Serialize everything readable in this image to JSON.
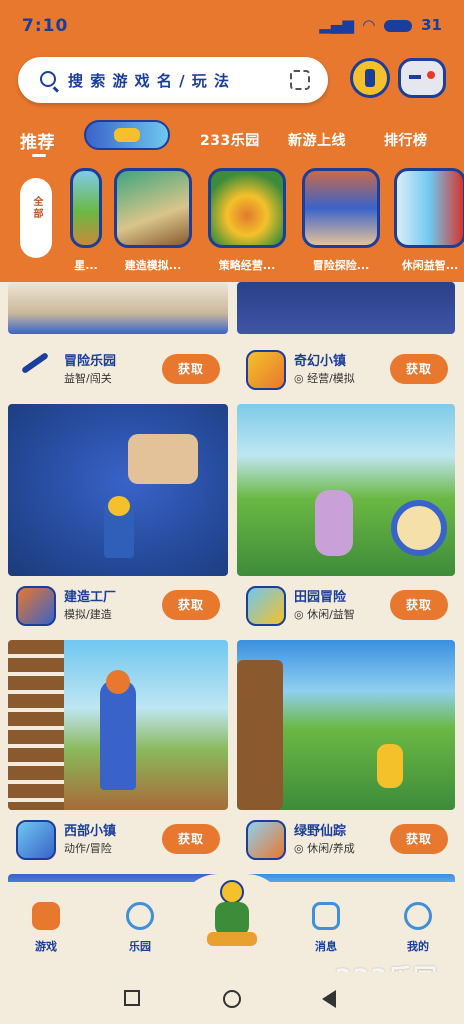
{
  "status": {
    "time": "7:10",
    "icons": [
      "signal-icon",
      "wifi-icon",
      "battery-icon"
    ],
    "battery_text": "31"
  },
  "search": {
    "placeholder": "搜 索 游 戏 名 / 玩 法"
  },
  "tabs": [
    {
      "label": "推荐",
      "active": true
    },
    {
      "label": "233乐园",
      "active": false
    },
    {
      "label": "新游上线",
      "active": false
    },
    {
      "label": "排行榜",
      "active": false
    }
  ],
  "side_tab": {
    "label": "全部"
  },
  "chips": [
    {
      "label": "星..."
    },
    {
      "label": "建造模拟..."
    },
    {
      "label": "策略经营..."
    },
    {
      "label": "冒险探险..."
    },
    {
      "label": "休闲益智..."
    }
  ],
  "cards": [
    {
      "title": "冒险乐园",
      "subtitle": "益智/闯关",
      "button": "获取"
    },
    {
      "title": "奇幻小镇",
      "subtitle": "◎ 经营/模拟",
      "button": "获取"
    },
    {
      "title": "建造工厂",
      "subtitle": "模拟/建造",
      "button": "获取"
    },
    {
      "title": "田园冒险",
      "subtitle": "◎ 休闲/益智",
      "button": "获取"
    },
    {
      "title": "西部小镇",
      "subtitle": "动作/冒险",
      "button": "获取"
    },
    {
      "title": "绿野仙踪",
      "subtitle": "◎ 休闲/养成",
      "button": "获取"
    }
  ],
  "bottom_nav": [
    {
      "label": "游戏",
      "icon": "gamepad-icon",
      "active": true
    },
    {
      "label": "乐园",
      "icon": "planet-icon",
      "active": false
    },
    {
      "label": "消息",
      "icon": "message-icon",
      "active": false
    },
    {
      "label": "我的",
      "icon": "user-icon",
      "active": false
    }
  ],
  "watermark": "233乐园",
  "colors": {
    "accent": "#e8782e",
    "brand_blue": "#1b3e9a",
    "background": "#f3ecdd"
  }
}
